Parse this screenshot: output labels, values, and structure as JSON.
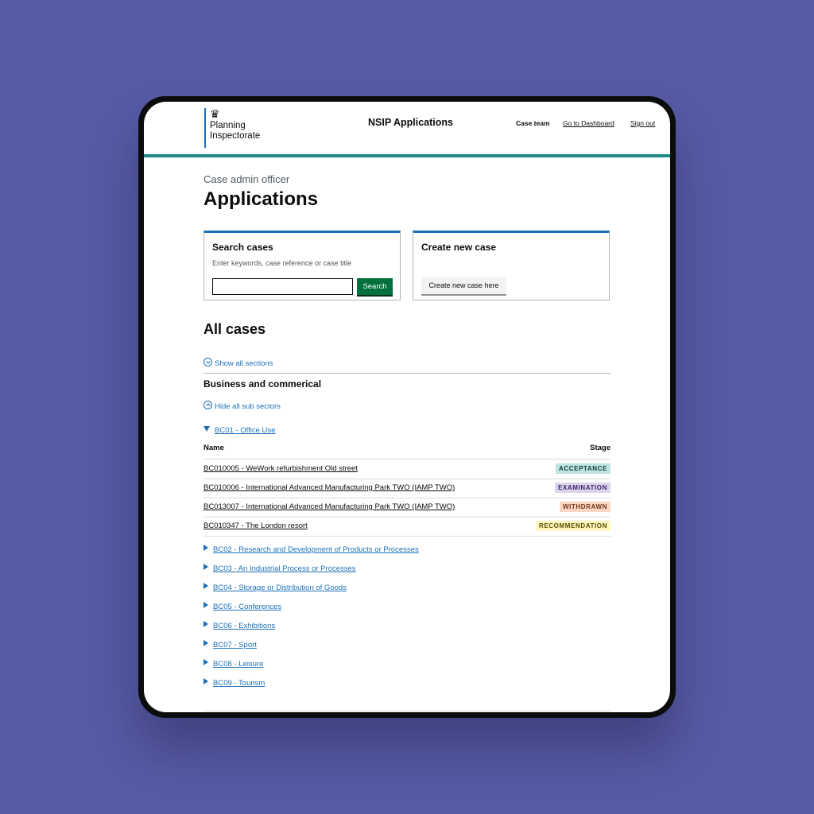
{
  "header": {
    "logo_line1": "Planning",
    "logo_line2": "Inspectorate",
    "service_name": "NSIP Applications",
    "nav": {
      "case_team": "Case team",
      "dashboard": "Go to Dashboard",
      "sign_out": "Sign out"
    }
  },
  "page": {
    "caption": "Case admin officer",
    "title": "Applications"
  },
  "search_card": {
    "title": "Search cases",
    "hint": "Enter keywords, case reference or case title",
    "input_value": "",
    "button": "Search"
  },
  "create_card": {
    "title": "Create new case",
    "button": "Create new case here"
  },
  "all_cases": {
    "title": "All cases",
    "show_all": "Show all sections",
    "sector": {
      "title": "Business and commerical",
      "hide_sub": "Hide all sub sectors",
      "open_subsector": "BC01 - Office Use",
      "table_headers": {
        "name": "Name",
        "stage": "Stage"
      },
      "rows": [
        {
          "name": "BC010005 - WeWork refurbishment Old street",
          "stage": "ACCEPTANCE",
          "tag_bg": "#bfe3e0",
          "tag_fg": "#10403c"
        },
        {
          "name": "BC010006 - International Advanced Manufacturing Park TWO (IAMP TWO)",
          "stage": "EXAMINATION",
          "tag_bg": "#dbd5e9",
          "tag_fg": "#3d2375"
        },
        {
          "name": "BC013007 - International Advanced Manufacturing Park TWO (IAMP TWO)",
          "stage": "WITHDRAWN",
          "tag_bg": "#fcd6c3",
          "tag_fg": "#6e3619"
        },
        {
          "name": "BC010347 - The London resort",
          "stage": "RECOMMENDATION",
          "tag_bg": "#fff7bf",
          "tag_fg": "#594d00"
        }
      ],
      "subsectors": [
        "BC02 - Research and Development of Products or Processes",
        "BC03 - An Industrial Process or Processes",
        "BC04 - Storage or Distribution of Goods",
        "BC05 - Conferences",
        "BC06 - Exhibitions",
        "BC07 - Sport",
        "BC08 - Leisure",
        "BC09 - Tourism"
      ]
    }
  },
  "colors": {
    "background": "#575ba5",
    "link": "#1d70b8",
    "header_rule": "#1d8a85",
    "search_button": "#00703c"
  },
  "icons": {
    "crest": "royal-crest-icon"
  }
}
